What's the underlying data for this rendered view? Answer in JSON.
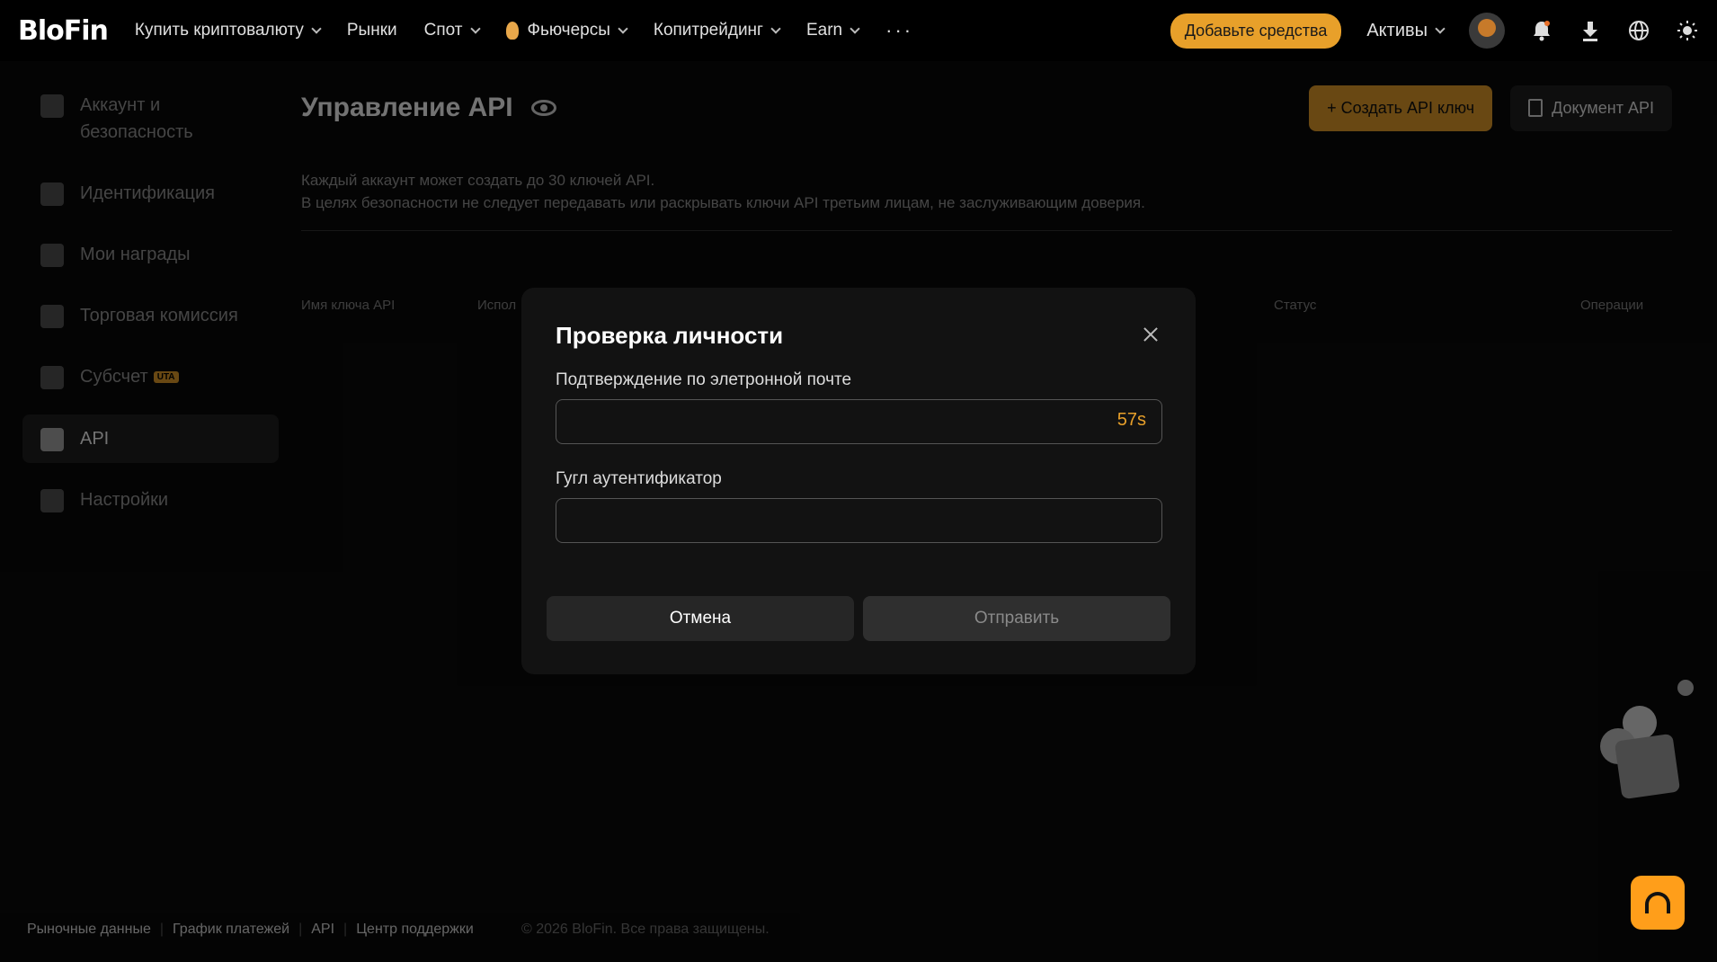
{
  "nav": {
    "logo": "BloFin",
    "items": [
      {
        "label": "Купить криптовалюту",
        "dropdown": true
      },
      {
        "label": "Рынки",
        "dropdown": false
      },
      {
        "label": "Спот",
        "dropdown": true
      },
      {
        "label": "Фьючерсы",
        "dropdown": true
      },
      {
        "label": "Копитрейдинг",
        "dropdown": true
      },
      {
        "label": "Earn",
        "dropdown": true
      }
    ],
    "more": "···",
    "deposit_label": "Добавьте средства",
    "assets_label": "Активы",
    "icons": [
      "avatar",
      "bell-icon",
      "download-icon",
      "globe-icon",
      "sun-icon"
    ]
  },
  "sidebar": {
    "items": [
      {
        "label": "Аккаунт и безопасность",
        "icon": "shield-icon"
      },
      {
        "label": "Идентификация",
        "icon": "id-card-icon"
      },
      {
        "label": "Мои награды",
        "icon": "ticket-icon"
      },
      {
        "label": "Торговая комиссия",
        "icon": "fee-icon"
      },
      {
        "label": "Субсчет",
        "icon": "sub-account-icon",
        "badge": "UTA"
      },
      {
        "label": "API",
        "icon": "api-icon",
        "active": true
      },
      {
        "label": "Настройки",
        "icon": "settings-icon"
      }
    ]
  },
  "main": {
    "title": "Управление API",
    "create_label": "+ Создать API ключ",
    "doc_label": "Документ API",
    "desc_line1": "Каждый аккаунт может создать до 30 ключей API.",
    "desc_line2": "В целях безопасности не следует передавать или раскрывать ключи API третьим лицам, не заслуживающим доверия.",
    "columns": {
      "name": "Имя ключа API",
      "usage": "Испол",
      "status": "Статус",
      "ops": "Операции"
    }
  },
  "modal": {
    "title": "Проверка личности",
    "email_label": "Подтверждение по элетронной почте",
    "email_value": "",
    "timer": "57s",
    "google_label": "Гугл аутентификатор",
    "google_value": "",
    "cancel_label": "Отмена",
    "submit_label": "Отправить"
  },
  "footer": {
    "links": [
      "Рыночные данные",
      "График платежей",
      "API",
      "Центр поддержки"
    ],
    "copyright": "© 2026 BloFin. Все права защищены."
  },
  "colors": {
    "accent": "#e8a02a",
    "background": "#0b0b0b",
    "support": "#ff9e1a"
  }
}
